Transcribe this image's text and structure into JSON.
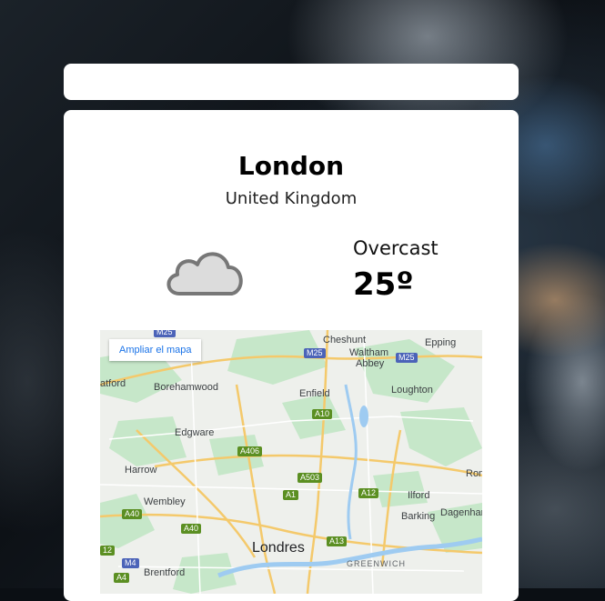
{
  "search": {
    "placeholder": ""
  },
  "weather": {
    "city": "London",
    "country": "United Kingdom",
    "condition": "Overcast",
    "temperature": "25º",
    "icon": "cloud-icon"
  },
  "map": {
    "enlarge_label": "Ampliar el mapa",
    "places": [
      "Cheshunt",
      "Epping",
      "Waltham",
      "Abbey",
      "atford",
      "Borehamwood",
      "Enfield",
      "Loughton",
      "Edgware",
      "Harrow",
      "Ilford",
      "Rom",
      "Wembley",
      "Barking",
      "Dagenhan",
      "Londres",
      "Brentford",
      "GREENWICH"
    ],
    "roads": [
      "M25",
      "M25",
      "M25",
      "A10",
      "A406",
      "A503",
      "A1",
      "A12",
      "A40",
      "A40",
      "A13",
      "M4",
      "A4",
      "12"
    ]
  },
  "colors": {
    "card": "#ffffff",
    "map_link": "#1a73e8"
  }
}
